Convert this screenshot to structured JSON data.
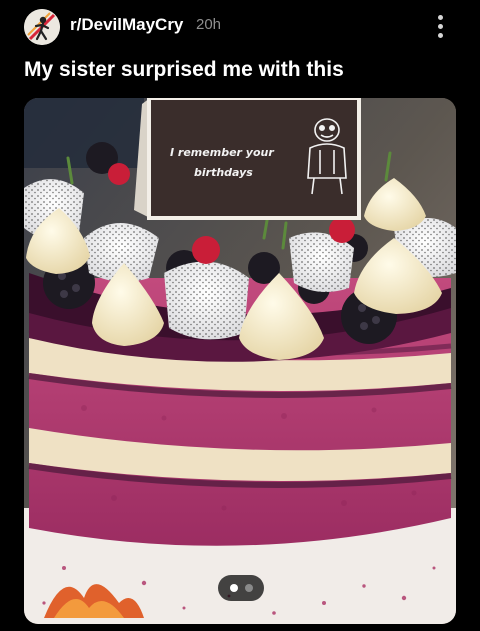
{
  "post": {
    "subreddit": "r/DevilMayCry",
    "time": "20h",
    "title": "My sister surprised me with this"
  },
  "image": {
    "card_text_line1": "I remember your",
    "card_text_line2": "birthdays",
    "page_count": 2,
    "current_page": 1
  },
  "colors": {
    "background": "#000000",
    "muted_text": "#8f8f8f",
    "cake_sponge": "#b23a6e",
    "cream_layer": "#efe1c4",
    "card": "#3a2d2b"
  }
}
